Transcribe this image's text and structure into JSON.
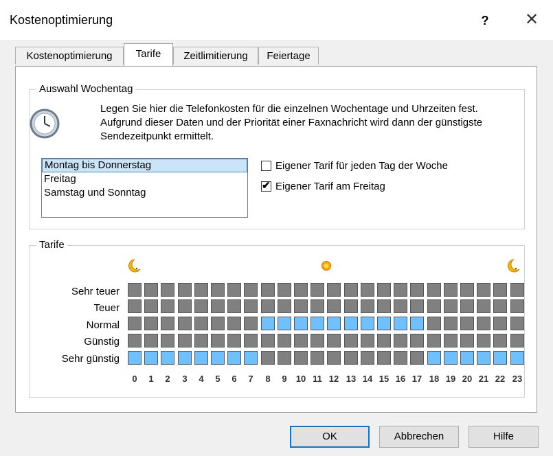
{
  "window": {
    "title": "Kostenoptimierung",
    "help_label": "?",
    "close_label": "✕"
  },
  "tabs": [
    {
      "label": "Kostenoptimierung"
    },
    {
      "label": "Tarife"
    },
    {
      "label": "Zeitlimitierung"
    },
    {
      "label": "Feiertage"
    }
  ],
  "weekday_group": {
    "label": "Auswahl Wochentag",
    "description": "Legen Sie hier die Telefonkosten für die einzelnen Wochentage und Uhrzeiten fest. Aufgrund dieser Daten und der Priorität einer Faxnachricht wird dann der günstigste Sendezeitpunkt ermittelt.",
    "list": [
      {
        "label": "Montag bis Donnerstag",
        "selected": true
      },
      {
        "label": "Freitag",
        "selected": false
      },
      {
        "label": "Samstag und Sonntag",
        "selected": false
      }
    ],
    "checkboxes": [
      {
        "label": "Eigener Tarif für jeden Tag der Woche",
        "checked": false
      },
      {
        "label": "Eigener Tarif am Freitag",
        "checked": true
      }
    ]
  },
  "tariff_group": {
    "label": "Tarife",
    "rows": [
      {
        "label": "Sehr teuer",
        "selected_hours": []
      },
      {
        "label": "Teuer",
        "selected_hours": []
      },
      {
        "label": "Normal",
        "selected_hours": [
          8,
          9,
          10,
          11,
          12,
          13,
          14,
          15,
          16,
          17
        ]
      },
      {
        "label": "Günstig",
        "selected_hours": []
      },
      {
        "label": "Sehr günstig",
        "selected_hours": [
          0,
          1,
          2,
          3,
          4,
          5,
          6,
          7,
          18,
          19,
          20,
          21,
          22,
          23
        ]
      }
    ],
    "hours": [
      "0",
      "1",
      "2",
      "3",
      "4",
      "5",
      "6",
      "7",
      "8",
      "9",
      "10",
      "11",
      "12",
      "13",
      "14",
      "15",
      "16",
      "17",
      "18",
      "19",
      "20",
      "21",
      "22",
      "23"
    ],
    "colors": {
      "selected": "#6ec0ff",
      "unselected": "#808080"
    }
  },
  "buttons": {
    "ok": "OK",
    "cancel": "Abbrechen",
    "help": "Hilfe"
  }
}
